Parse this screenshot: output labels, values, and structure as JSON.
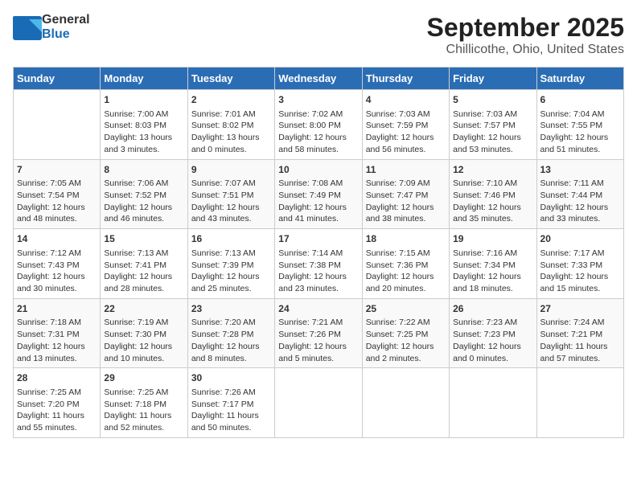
{
  "header": {
    "logo_line1": "General",
    "logo_line2": "Blue",
    "month": "September 2025",
    "location": "Chillicothe, Ohio, United States"
  },
  "days_of_week": [
    "Sunday",
    "Monday",
    "Tuesday",
    "Wednesday",
    "Thursday",
    "Friday",
    "Saturday"
  ],
  "weeks": [
    [
      {
        "day": "",
        "info": ""
      },
      {
        "day": "1",
        "info": "Sunrise: 7:00 AM\nSunset: 8:03 PM\nDaylight: 13 hours\nand 3 minutes."
      },
      {
        "day": "2",
        "info": "Sunrise: 7:01 AM\nSunset: 8:02 PM\nDaylight: 13 hours\nand 0 minutes."
      },
      {
        "day": "3",
        "info": "Sunrise: 7:02 AM\nSunset: 8:00 PM\nDaylight: 12 hours\nand 58 minutes."
      },
      {
        "day": "4",
        "info": "Sunrise: 7:03 AM\nSunset: 7:59 PM\nDaylight: 12 hours\nand 56 minutes."
      },
      {
        "day": "5",
        "info": "Sunrise: 7:03 AM\nSunset: 7:57 PM\nDaylight: 12 hours\nand 53 minutes."
      },
      {
        "day": "6",
        "info": "Sunrise: 7:04 AM\nSunset: 7:55 PM\nDaylight: 12 hours\nand 51 minutes."
      }
    ],
    [
      {
        "day": "7",
        "info": "Sunrise: 7:05 AM\nSunset: 7:54 PM\nDaylight: 12 hours\nand 48 minutes."
      },
      {
        "day": "8",
        "info": "Sunrise: 7:06 AM\nSunset: 7:52 PM\nDaylight: 12 hours\nand 46 minutes."
      },
      {
        "day": "9",
        "info": "Sunrise: 7:07 AM\nSunset: 7:51 PM\nDaylight: 12 hours\nand 43 minutes."
      },
      {
        "day": "10",
        "info": "Sunrise: 7:08 AM\nSunset: 7:49 PM\nDaylight: 12 hours\nand 41 minutes."
      },
      {
        "day": "11",
        "info": "Sunrise: 7:09 AM\nSunset: 7:47 PM\nDaylight: 12 hours\nand 38 minutes."
      },
      {
        "day": "12",
        "info": "Sunrise: 7:10 AM\nSunset: 7:46 PM\nDaylight: 12 hours\nand 35 minutes."
      },
      {
        "day": "13",
        "info": "Sunrise: 7:11 AM\nSunset: 7:44 PM\nDaylight: 12 hours\nand 33 minutes."
      }
    ],
    [
      {
        "day": "14",
        "info": "Sunrise: 7:12 AM\nSunset: 7:43 PM\nDaylight: 12 hours\nand 30 minutes."
      },
      {
        "day": "15",
        "info": "Sunrise: 7:13 AM\nSunset: 7:41 PM\nDaylight: 12 hours\nand 28 minutes."
      },
      {
        "day": "16",
        "info": "Sunrise: 7:13 AM\nSunset: 7:39 PM\nDaylight: 12 hours\nand 25 minutes."
      },
      {
        "day": "17",
        "info": "Sunrise: 7:14 AM\nSunset: 7:38 PM\nDaylight: 12 hours\nand 23 minutes."
      },
      {
        "day": "18",
        "info": "Sunrise: 7:15 AM\nSunset: 7:36 PM\nDaylight: 12 hours\nand 20 minutes."
      },
      {
        "day": "19",
        "info": "Sunrise: 7:16 AM\nSunset: 7:34 PM\nDaylight: 12 hours\nand 18 minutes."
      },
      {
        "day": "20",
        "info": "Sunrise: 7:17 AM\nSunset: 7:33 PM\nDaylight: 12 hours\nand 15 minutes."
      }
    ],
    [
      {
        "day": "21",
        "info": "Sunrise: 7:18 AM\nSunset: 7:31 PM\nDaylight: 12 hours\nand 13 minutes."
      },
      {
        "day": "22",
        "info": "Sunrise: 7:19 AM\nSunset: 7:30 PM\nDaylight: 12 hours\nand 10 minutes."
      },
      {
        "day": "23",
        "info": "Sunrise: 7:20 AM\nSunset: 7:28 PM\nDaylight: 12 hours\nand 8 minutes."
      },
      {
        "day": "24",
        "info": "Sunrise: 7:21 AM\nSunset: 7:26 PM\nDaylight: 12 hours\nand 5 minutes."
      },
      {
        "day": "25",
        "info": "Sunrise: 7:22 AM\nSunset: 7:25 PM\nDaylight: 12 hours\nand 2 minutes."
      },
      {
        "day": "26",
        "info": "Sunrise: 7:23 AM\nSunset: 7:23 PM\nDaylight: 12 hours\nand 0 minutes."
      },
      {
        "day": "27",
        "info": "Sunrise: 7:24 AM\nSunset: 7:21 PM\nDaylight: 11 hours\nand 57 minutes."
      }
    ],
    [
      {
        "day": "28",
        "info": "Sunrise: 7:25 AM\nSunset: 7:20 PM\nDaylight: 11 hours\nand 55 minutes."
      },
      {
        "day": "29",
        "info": "Sunrise: 7:25 AM\nSunset: 7:18 PM\nDaylight: 11 hours\nand 52 minutes."
      },
      {
        "day": "30",
        "info": "Sunrise: 7:26 AM\nSunset: 7:17 PM\nDaylight: 11 hours\nand 50 minutes."
      },
      {
        "day": "",
        "info": ""
      },
      {
        "day": "",
        "info": ""
      },
      {
        "day": "",
        "info": ""
      },
      {
        "day": "",
        "info": ""
      }
    ]
  ]
}
